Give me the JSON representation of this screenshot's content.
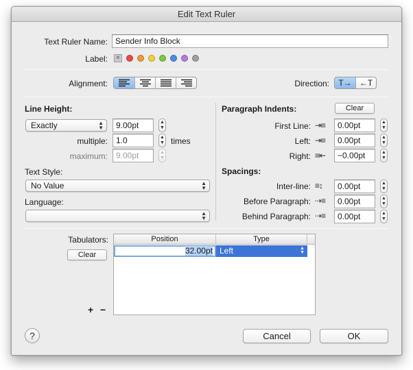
{
  "window": {
    "title": "Edit Text Ruler"
  },
  "ruler": {
    "name_label": "Text Ruler Name:",
    "name_value": "Sender Info Block",
    "label_label": "Label:",
    "label_colors": [
      "#e84a4a",
      "#f29a38",
      "#f0d33a",
      "#7cc94a",
      "#4a8de8",
      "#b57ad9",
      "#a0a0a0"
    ]
  },
  "alignment": {
    "label": "Alignment:",
    "selected": "left"
  },
  "direction": {
    "label": "Direction:",
    "ltr_glyph": "T→",
    "rtl_glyph": "←T",
    "selected": "ltr"
  },
  "line_height": {
    "heading": "Line Height:",
    "mode": "Exactly",
    "value": "9.00pt",
    "multiple_label": "multiple:",
    "multiple_value": "1.0",
    "times_label": "times",
    "maximum_label": "maximum:",
    "maximum_value": "9.00pt"
  },
  "text_style": {
    "label": "Text Style:",
    "value": "No Value"
  },
  "language": {
    "label": "Language:",
    "value": ""
  },
  "paragraph_indents": {
    "heading": "Paragraph Indents:",
    "clear_label": "Clear",
    "first_line_label": "First Line:",
    "first_line_value": "0.00pt",
    "left_label": "Left:",
    "left_value": "0.00pt",
    "right_label": "Right:",
    "right_value": "−0.00pt"
  },
  "spacings": {
    "heading": "Spacings:",
    "inter_line_label": "Inter-line:",
    "inter_line_value": "0.00pt",
    "before_label": "Before Paragraph:",
    "before_value": "0.00pt",
    "behind_label": "Behind Paragraph:",
    "behind_value": "0.00pt"
  },
  "tabulators": {
    "label": "Tabulators:",
    "clear_label": "Clear",
    "add_label": "+",
    "remove_label": "−",
    "columns": [
      "Position",
      "Type"
    ],
    "rows": [
      {
        "position": "32.00pt",
        "type": "Left"
      }
    ]
  },
  "footer": {
    "help_label": "?",
    "cancel_label": "Cancel",
    "ok_label": "OK"
  }
}
